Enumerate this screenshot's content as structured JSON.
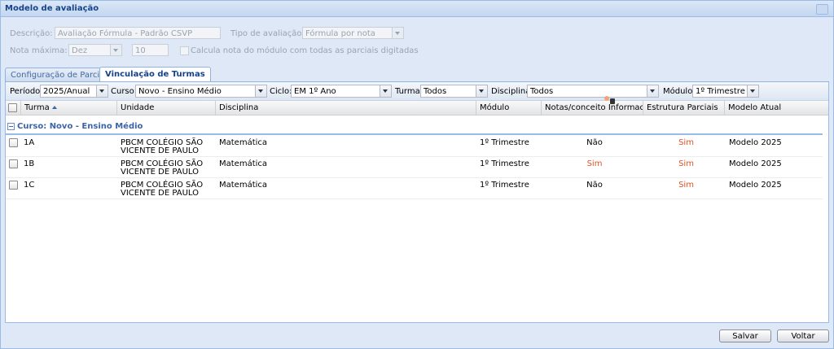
{
  "window": {
    "title": "Modelo de avaliação"
  },
  "form": {
    "descricao_label": "Descrição:",
    "descricao_value": "Avaliação Fórmula - Padrão CSVP",
    "tipo_label": "Tipo de avaliação:",
    "tipo_value": "Fórmula por nota",
    "nota_label": "Nota máxima:",
    "nota_select": "Dez",
    "nota_value": "10",
    "calcula_label": "Calcula nota do módulo com todas as parciais digitadas"
  },
  "tabs": [
    {
      "label": "Configuração de Parciais"
    },
    {
      "label": "Vinculação de Turmas"
    }
  ],
  "filters": {
    "periodo_label": "Período:",
    "periodo_value": "2025/Anual",
    "curso_label": "Curso:",
    "curso_value": "Novo - Ensino Médio",
    "ciclo_label": "Ciclo:",
    "ciclo_value": "EM 1º Ano",
    "turma_label": "Turma:",
    "turma_value": "Todos",
    "disciplina_label": "Disciplina:",
    "disciplina_value": "Todos",
    "modulo_label": "Módulo:",
    "modulo_value": "1º Trimestre"
  },
  "grid": {
    "columns": [
      "Turma",
      "Unidade",
      "Disciplina",
      "Módulo",
      "Notas/conceito Informadas",
      "Estrutura Parciais",
      "Modelo Atual"
    ],
    "group": "Curso: Novo - Ensino Médio",
    "rows": [
      {
        "turma": "1A",
        "unidade1": "PBCM COLÉGIO SÃO",
        "unidade2": "VICENTE DE PAULO",
        "disciplina": "Matemática",
        "modulo": "1º Trimestre",
        "notas": "Não",
        "estrutura": "Sim",
        "modelo": "Modelo 2025"
      },
      {
        "turma": "1B",
        "unidade1": "PBCM COLÉGIO SÃO",
        "unidade2": "VICENTE DE PAULO",
        "disciplina": "Matemática",
        "modulo": "1º Trimestre",
        "notas": "Sim",
        "estrutura": "Sim",
        "modelo": "Modelo 2025"
      },
      {
        "turma": "1C",
        "unidade1": "PBCM COLÉGIO SÃO",
        "unidade2": "VICENTE DE PAULO",
        "disciplina": "Matemática",
        "modulo": "1º Trimestre",
        "notas": "Não",
        "estrutura": "Sim",
        "modelo": "Modelo 2025"
      }
    ]
  },
  "buttons": {
    "salvar": "Salvar",
    "voltar": "Voltar"
  },
  "colors": {
    "accent": "#15428b",
    "highlight": "#e05020",
    "border": "#99bbe8"
  }
}
